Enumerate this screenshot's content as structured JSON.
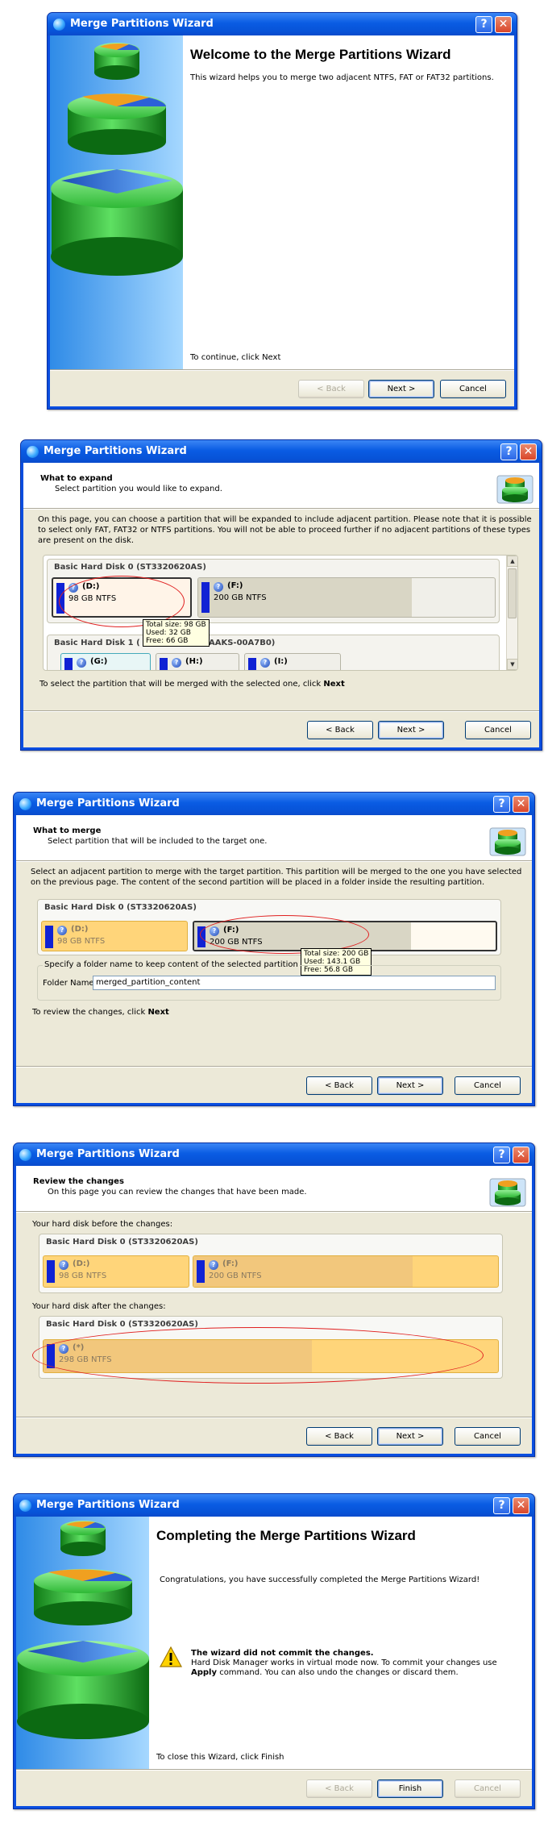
{
  "window_title": "Merge Partitions Wizard",
  "title_help": "?",
  "title_close": "✕",
  "buttons": {
    "back": "< Back",
    "next": "Next >",
    "cancel": "Cancel",
    "finish": "Finish"
  },
  "icons": {
    "help": "question-icon",
    "close": "close-icon",
    "warning": "warning-icon",
    "partition": "partition-icon"
  },
  "colors": {
    "titlebar": "#0a5ce3",
    "selection_ellipse": "#e02020",
    "target_partition": "#ffd57a"
  },
  "step1": {
    "title": "Welcome to the Merge Partitions Wizard",
    "text": "This wizard helps you to merge two adjacent NTFS, FAT or FAT32 partitions.",
    "footer": "To continue, click Next"
  },
  "step2": {
    "header_title": "What to expand",
    "header_sub": "Select partition you would like to expand.",
    "intro": "On this page, you can choose a partition that will be expanded to include adjacent partition. Please note that it is possible to select only FAT, FAT32 or NTFS partitions. You will not be able to proceed further if no adjacent partitions of these types are present on the disk.",
    "disk0": "Basic Hard Disk 0 (ST3320620AS)",
    "disk1": "Basic Hard Disk 1 (",
    "disk1_rest": "AAKS-00A7B0)",
    "partitions": [
      {
        "letter": "(D:)",
        "size": "98 GB NTFS",
        "used_fraction": 0.33
      },
      {
        "letter": "(F:)",
        "size": "200 GB NTFS",
        "used_fraction": 0.72
      }
    ],
    "disk1_partitions": [
      "(G:)",
      "(H:)",
      "(I:)"
    ],
    "tooltip": [
      "Total size: 98 GB",
      "Used: 32 GB",
      "Free: 66 GB"
    ],
    "footer_pre": "To select the partition that will be merged with the selected one, click ",
    "footer_bold": "Next"
  },
  "step3": {
    "header_title": "What to merge",
    "header_sub": "Select partition that will be included to the target one.",
    "intro": "Select an adjacent partition to merge with the target partition. This partition will be merged to the one you have selected on the previous page. The content of the second partition will be placed in a folder inside the resulting partition.",
    "disk0": "Basic Hard Disk 0 (ST3320620AS)",
    "partitions": [
      {
        "letter": "(D:)",
        "size": "98 GB NTFS"
      },
      {
        "letter": "(F:)",
        "size": "200 GB NTFS",
        "used_fraction": 0.72
      }
    ],
    "tooltip": [
      "Total size: 200 GB",
      "Used: 143.1 GB",
      "Free: 56.8 GB"
    ],
    "folder_group": "Specify a folder name to keep content of the selected partition",
    "folder_label": "Folder Name",
    "folder_value": "merged_partition_content",
    "footer_pre": "To review the changes, click ",
    "footer_bold": "Next"
  },
  "step4": {
    "header_title": "Review the changes",
    "header_sub": "On this page you can review the changes that have been made.",
    "before_label": "Your hard disk before the changes:",
    "after_label": "Your hard disk after the changes:",
    "disk0": "Basic Hard Disk 0 (ST3320620AS)",
    "before": [
      {
        "letter": "(D:)",
        "size": "98 GB NTFS"
      },
      {
        "letter": "(F:)",
        "size": "200 GB NTFS"
      }
    ],
    "after": {
      "letter": "(*)",
      "size": "298 GB NTFS",
      "used_fraction": 0.59
    }
  },
  "step5": {
    "title": "Completing the Merge Partitions Wizard",
    "text": "Congratulations, you have successfully completed the Merge Partitions Wizard!",
    "warn_title": "The wizard did not commit the changes.",
    "warn_line1": "Hard Disk Manager works in virtual mode now. To commit your changes use",
    "warn_bold": "Apply",
    "warn_line2": " command. You can also undo the changes or discard them.",
    "footer": "To close this Wizard, click Finish"
  }
}
